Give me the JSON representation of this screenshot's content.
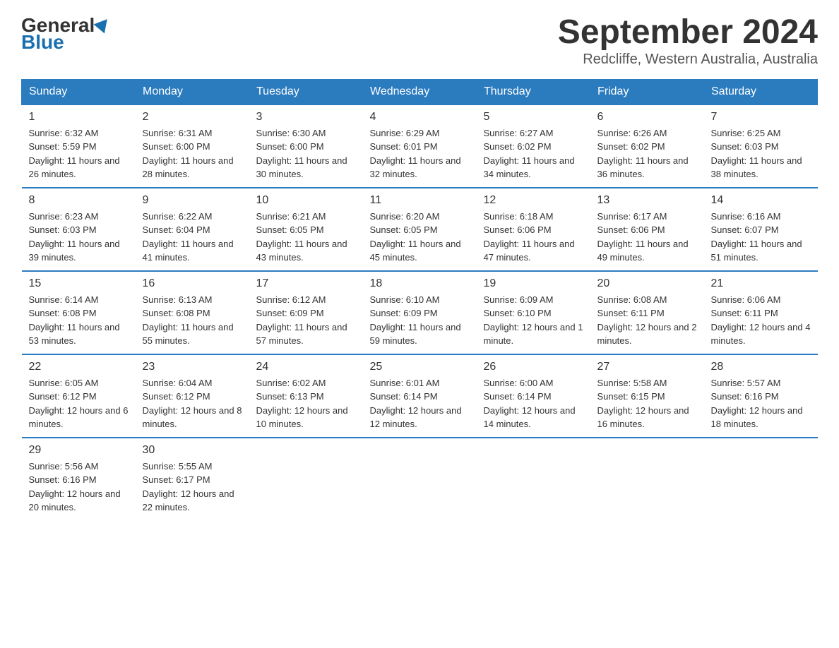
{
  "header": {
    "logo_general": "General",
    "logo_blue": "Blue",
    "title": "September 2024",
    "subtitle": "Redcliffe, Western Australia, Australia"
  },
  "weekdays": [
    "Sunday",
    "Monday",
    "Tuesday",
    "Wednesday",
    "Thursday",
    "Friday",
    "Saturday"
  ],
  "weeks": [
    [
      {
        "day": "1",
        "sunrise": "6:32 AM",
        "sunset": "5:59 PM",
        "daylight": "11 hours and 26 minutes."
      },
      {
        "day": "2",
        "sunrise": "6:31 AM",
        "sunset": "6:00 PM",
        "daylight": "11 hours and 28 minutes."
      },
      {
        "day": "3",
        "sunrise": "6:30 AM",
        "sunset": "6:00 PM",
        "daylight": "11 hours and 30 minutes."
      },
      {
        "day": "4",
        "sunrise": "6:29 AM",
        "sunset": "6:01 PM",
        "daylight": "11 hours and 32 minutes."
      },
      {
        "day": "5",
        "sunrise": "6:27 AM",
        "sunset": "6:02 PM",
        "daylight": "11 hours and 34 minutes."
      },
      {
        "day": "6",
        "sunrise": "6:26 AM",
        "sunset": "6:02 PM",
        "daylight": "11 hours and 36 minutes."
      },
      {
        "day": "7",
        "sunrise": "6:25 AM",
        "sunset": "6:03 PM",
        "daylight": "11 hours and 38 minutes."
      }
    ],
    [
      {
        "day": "8",
        "sunrise": "6:23 AM",
        "sunset": "6:03 PM",
        "daylight": "11 hours and 39 minutes."
      },
      {
        "day": "9",
        "sunrise": "6:22 AM",
        "sunset": "6:04 PM",
        "daylight": "11 hours and 41 minutes."
      },
      {
        "day": "10",
        "sunrise": "6:21 AM",
        "sunset": "6:05 PM",
        "daylight": "11 hours and 43 minutes."
      },
      {
        "day": "11",
        "sunrise": "6:20 AM",
        "sunset": "6:05 PM",
        "daylight": "11 hours and 45 minutes."
      },
      {
        "day": "12",
        "sunrise": "6:18 AM",
        "sunset": "6:06 PM",
        "daylight": "11 hours and 47 minutes."
      },
      {
        "day": "13",
        "sunrise": "6:17 AM",
        "sunset": "6:06 PM",
        "daylight": "11 hours and 49 minutes."
      },
      {
        "day": "14",
        "sunrise": "6:16 AM",
        "sunset": "6:07 PM",
        "daylight": "11 hours and 51 minutes."
      }
    ],
    [
      {
        "day": "15",
        "sunrise": "6:14 AM",
        "sunset": "6:08 PM",
        "daylight": "11 hours and 53 minutes."
      },
      {
        "day": "16",
        "sunrise": "6:13 AM",
        "sunset": "6:08 PM",
        "daylight": "11 hours and 55 minutes."
      },
      {
        "day": "17",
        "sunrise": "6:12 AM",
        "sunset": "6:09 PM",
        "daylight": "11 hours and 57 minutes."
      },
      {
        "day": "18",
        "sunrise": "6:10 AM",
        "sunset": "6:09 PM",
        "daylight": "11 hours and 59 minutes."
      },
      {
        "day": "19",
        "sunrise": "6:09 AM",
        "sunset": "6:10 PM",
        "daylight": "12 hours and 1 minute."
      },
      {
        "day": "20",
        "sunrise": "6:08 AM",
        "sunset": "6:11 PM",
        "daylight": "12 hours and 2 minutes."
      },
      {
        "day": "21",
        "sunrise": "6:06 AM",
        "sunset": "6:11 PM",
        "daylight": "12 hours and 4 minutes."
      }
    ],
    [
      {
        "day": "22",
        "sunrise": "6:05 AM",
        "sunset": "6:12 PM",
        "daylight": "12 hours and 6 minutes."
      },
      {
        "day": "23",
        "sunrise": "6:04 AM",
        "sunset": "6:12 PM",
        "daylight": "12 hours and 8 minutes."
      },
      {
        "day": "24",
        "sunrise": "6:02 AM",
        "sunset": "6:13 PM",
        "daylight": "12 hours and 10 minutes."
      },
      {
        "day": "25",
        "sunrise": "6:01 AM",
        "sunset": "6:14 PM",
        "daylight": "12 hours and 12 minutes."
      },
      {
        "day": "26",
        "sunrise": "6:00 AM",
        "sunset": "6:14 PM",
        "daylight": "12 hours and 14 minutes."
      },
      {
        "day": "27",
        "sunrise": "5:58 AM",
        "sunset": "6:15 PM",
        "daylight": "12 hours and 16 minutes."
      },
      {
        "day": "28",
        "sunrise": "5:57 AM",
        "sunset": "6:16 PM",
        "daylight": "12 hours and 18 minutes."
      }
    ],
    [
      {
        "day": "29",
        "sunrise": "5:56 AM",
        "sunset": "6:16 PM",
        "daylight": "12 hours and 20 minutes."
      },
      {
        "day": "30",
        "sunrise": "5:55 AM",
        "sunset": "6:17 PM",
        "daylight": "12 hours and 22 minutes."
      },
      null,
      null,
      null,
      null,
      null
    ]
  ]
}
